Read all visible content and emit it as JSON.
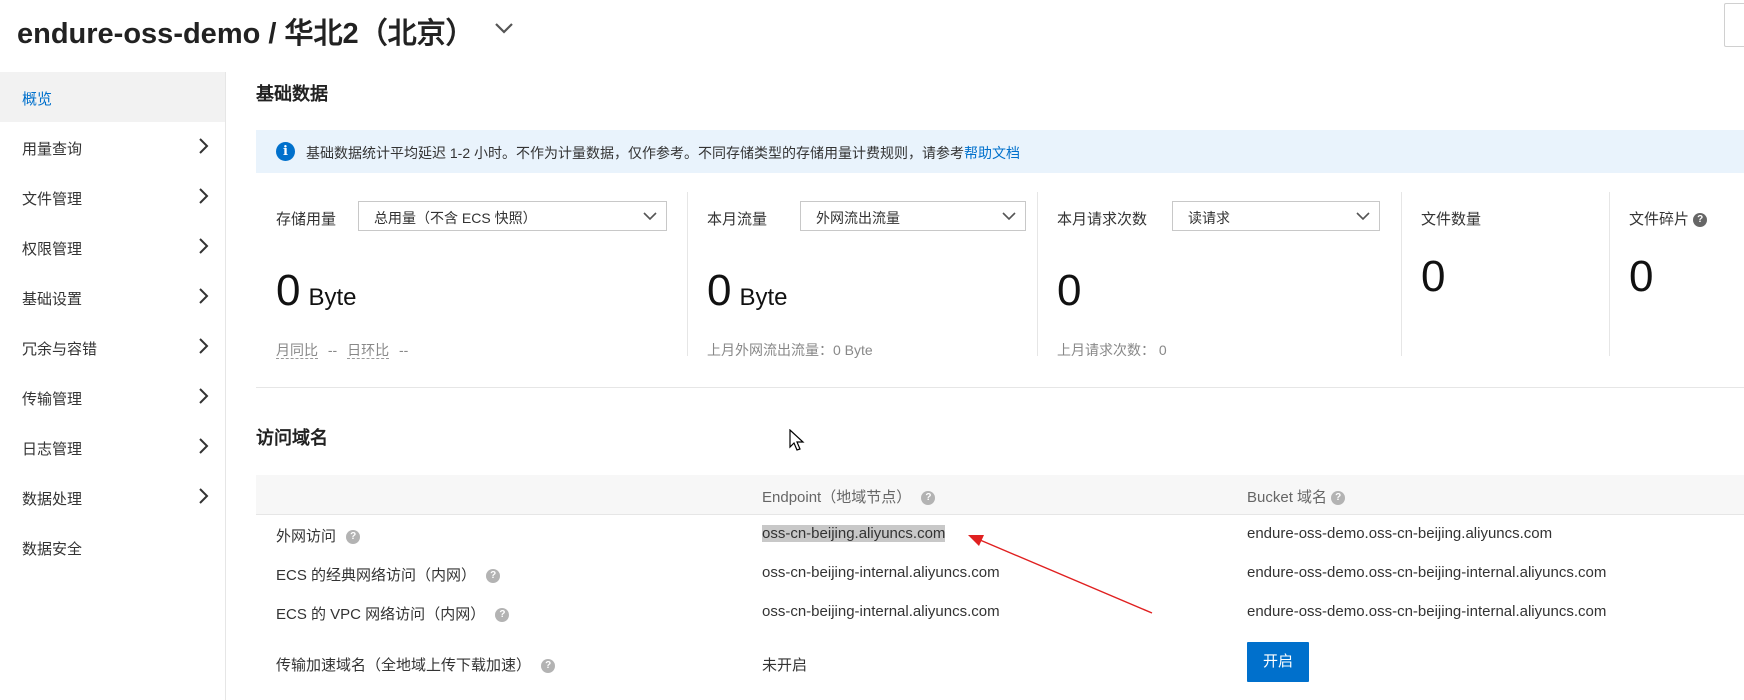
{
  "header": {
    "title": "endure-oss-demo / 华北2（北京）",
    "title_dropdown_icon": "chevron-down-icon"
  },
  "sidebar": {
    "items": [
      {
        "label": "概览",
        "active": true,
        "has_chevron": false
      },
      {
        "label": "用量查询",
        "active": false,
        "has_chevron": true
      },
      {
        "label": "文件管理",
        "active": false,
        "has_chevron": true
      },
      {
        "label": "权限管理",
        "active": false,
        "has_chevron": true
      },
      {
        "label": "基础设置",
        "active": false,
        "has_chevron": true
      },
      {
        "label": "冗余与容错",
        "active": false,
        "has_chevron": true
      },
      {
        "label": "传输管理",
        "active": false,
        "has_chevron": true
      },
      {
        "label": "日志管理",
        "active": false,
        "has_chevron": true
      },
      {
        "label": "数据处理",
        "active": false,
        "has_chevron": true
      },
      {
        "label": "数据安全",
        "active": false,
        "has_chevron": false
      }
    ]
  },
  "basic_data": {
    "title": "基础数据",
    "notice_text": "基础数据统计平均延迟 1-2 小时。不作为计量数据，仅作参考。不同存储类型的存储用量计费规则，请参考",
    "notice_link": "帮助文档",
    "storage": {
      "label": "存储用量",
      "select_value": "总用量（不含 ECS 快照）",
      "value": "0",
      "unit": "Byte",
      "yoy_label": "月同比",
      "yoy_value": "--",
      "mom_label": "日环比",
      "mom_value": "--"
    },
    "traffic": {
      "label": "本月流量",
      "select_value": "外网流出流量",
      "value": "0",
      "unit": "Byte",
      "sub_text": "上月外网流出流量：0 Byte"
    },
    "requests": {
      "label": "本月请求次数",
      "select_value": "读请求",
      "value": "0",
      "sub_text": "上月请求次数： 0"
    },
    "file_count": {
      "label": "文件数量",
      "value": "0"
    },
    "fragments": {
      "label": "文件碎片",
      "value": "0"
    }
  },
  "access_domains": {
    "title": "访问域名",
    "columns": [
      "Endpoint（地域节点）",
      "Bucket 域名"
    ],
    "rows": [
      {
        "name": "外网访问",
        "endpoint": "oss-cn-beijing.aliyuncs.com",
        "bucket": "endure-oss-demo.oss-cn-beijing.aliyuncs.com"
      },
      {
        "name": "ECS 的经典网络访问（内网）",
        "endpoint": "oss-cn-beijing-internal.aliyuncs.com",
        "bucket": "endure-oss-demo.oss-cn-beijing-internal.aliyuncs.com"
      },
      {
        "name": "ECS 的 VPC 网络访问（内网）",
        "endpoint": "oss-cn-beijing-internal.aliyuncs.com",
        "bucket": "endure-oss-demo.oss-cn-beijing-internal.aliyuncs.com"
      },
      {
        "name": "传输加速域名（全地域上传下载加速）",
        "endpoint": "未开启",
        "button": "开启"
      }
    ]
  },
  "colors": {
    "accent": "#0070cc",
    "notice_bg": "#e9f3fc",
    "annotation_arrow": "#e02020"
  }
}
